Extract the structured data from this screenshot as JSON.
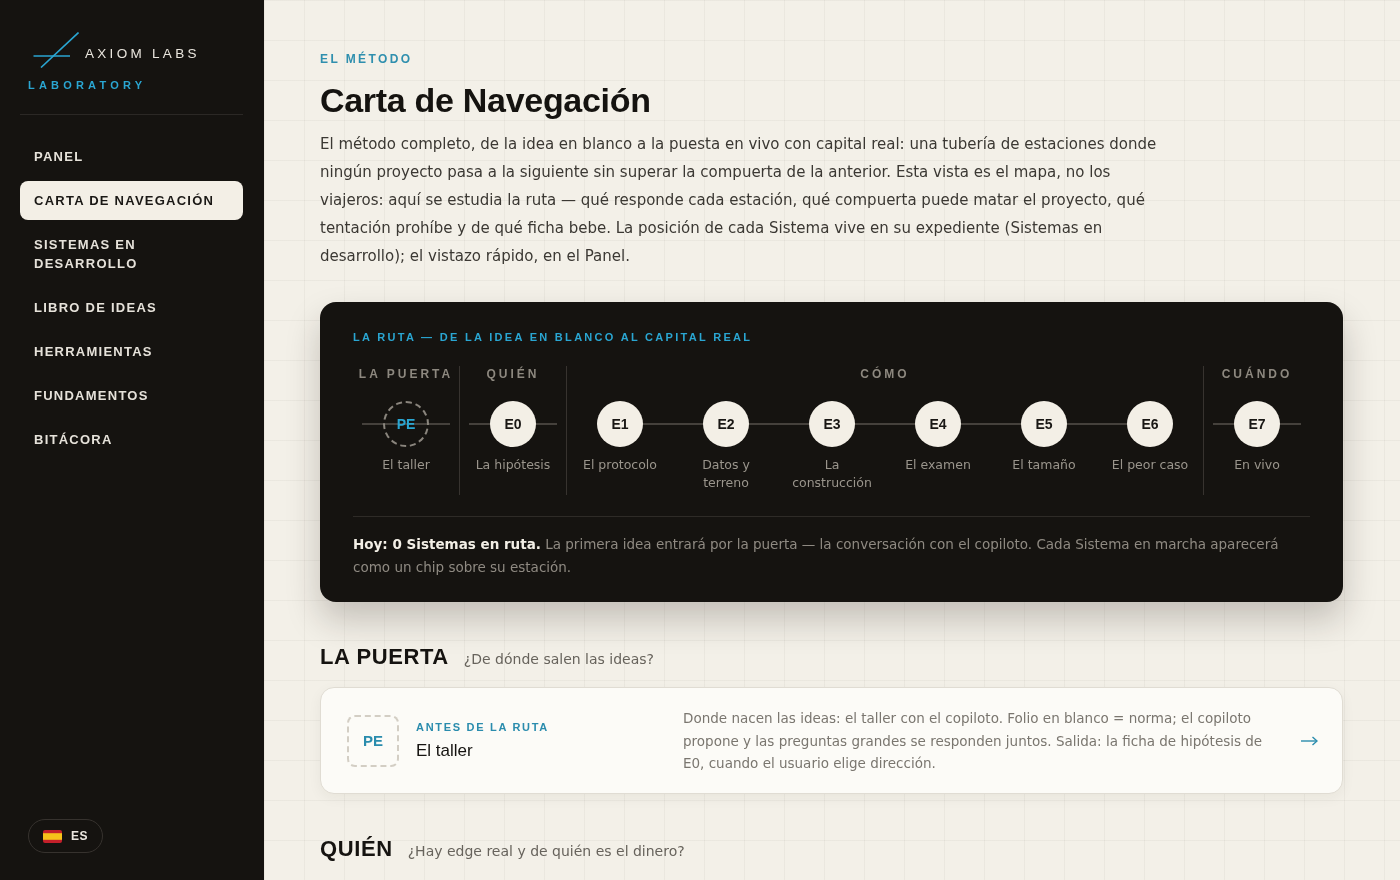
{
  "sidebar": {
    "logo": {
      "name": "AXIOM LABS",
      "tagline": "LABORATORY"
    },
    "nav_items": [
      {
        "label": "PANEL",
        "selected": false
      },
      {
        "label": "CARTA DE NAVEGACIÓN",
        "selected": true
      },
      {
        "label": "SISTEMAS EN DESARROLLO",
        "selected": false
      },
      {
        "label": "LIBRO DE IDEAS",
        "selected": false
      },
      {
        "label": "HERRAMIENTAS",
        "selected": false
      },
      {
        "label": "FUNDAMENTOS",
        "selected": false
      },
      {
        "label": "BITÁCORA",
        "selected": false
      }
    ],
    "language": {
      "code": "ES"
    }
  },
  "header": {
    "eyebrow": "EL MÉTODO",
    "title": "Carta de Navegación",
    "intro": "El método completo, de la idea en blanco a la puesta en vivo con capital real: una tubería de estaciones donde ningún proyecto pasa a la siguiente sin superar la compuerta de la anterior. Esta vista es el mapa, no los viajeros: aquí se estudia la ruta — qué responde cada estación, qué compuerta puede matar el proyecto, qué tentación prohíbe y de qué ficha bebe. La posición de cada Sistema vive en su expediente (Sistemas en desarrollo); el vistazo rápido, en el Panel."
  },
  "route_card": {
    "title": "LA RUTA — DE LA IDEA EN BLANCO AL CAPITAL REAL",
    "phases": [
      {
        "label": "LA PUERTA",
        "stations": [
          {
            "code": "PE",
            "name": "El taller",
            "kind": "gate"
          }
        ]
      },
      {
        "label": "QUIÉN",
        "stations": [
          {
            "code": "E0",
            "name": "La hipótesis",
            "kind": "station"
          }
        ]
      },
      {
        "label": "CÓMO",
        "stations": [
          {
            "code": "E1",
            "name": "El protocolo",
            "kind": "station"
          },
          {
            "code": "E2",
            "name": "Datos y terreno",
            "kind": "station"
          },
          {
            "code": "E3",
            "name": "La construcción",
            "kind": "station"
          },
          {
            "code": "E4",
            "name": "El examen",
            "kind": "station"
          },
          {
            "code": "E5",
            "name": "El tamaño",
            "kind": "station"
          },
          {
            "code": "E6",
            "name": "El peor caso",
            "kind": "station"
          }
        ]
      },
      {
        "label": "CUÁNDO",
        "stations": [
          {
            "code": "E7",
            "name": "En vivo",
            "kind": "station"
          }
        ]
      }
    ],
    "summary": "**Hoy: 0 Sistemas en ruta.** La primera idea entrará por la puerta — la conversación con el copiloto. Cada Sistema en marcha aparecerá como un chip sobre su estación."
  },
  "sections": [
    {
      "title": "LA PUERTA",
      "question": "¿De dónde salen las ideas?",
      "cards": [
        {
          "code": "PE",
          "kind": "gate",
          "eyebrow": "ANTES DE LA RUTA",
          "name": "El taller",
          "description": "Donde nacen las ideas: el taller con el copiloto. Folio en blanco = norma; el copiloto propone y las preguntas grandes se responden juntos. Salida: la ficha de hipótesis de E0, cuando el usuario elige dirección."
        }
      ]
    },
    {
      "title": "QUIÉN",
      "question": "¿Hay edge real y de quién es el dinero?"
    }
  ]
}
